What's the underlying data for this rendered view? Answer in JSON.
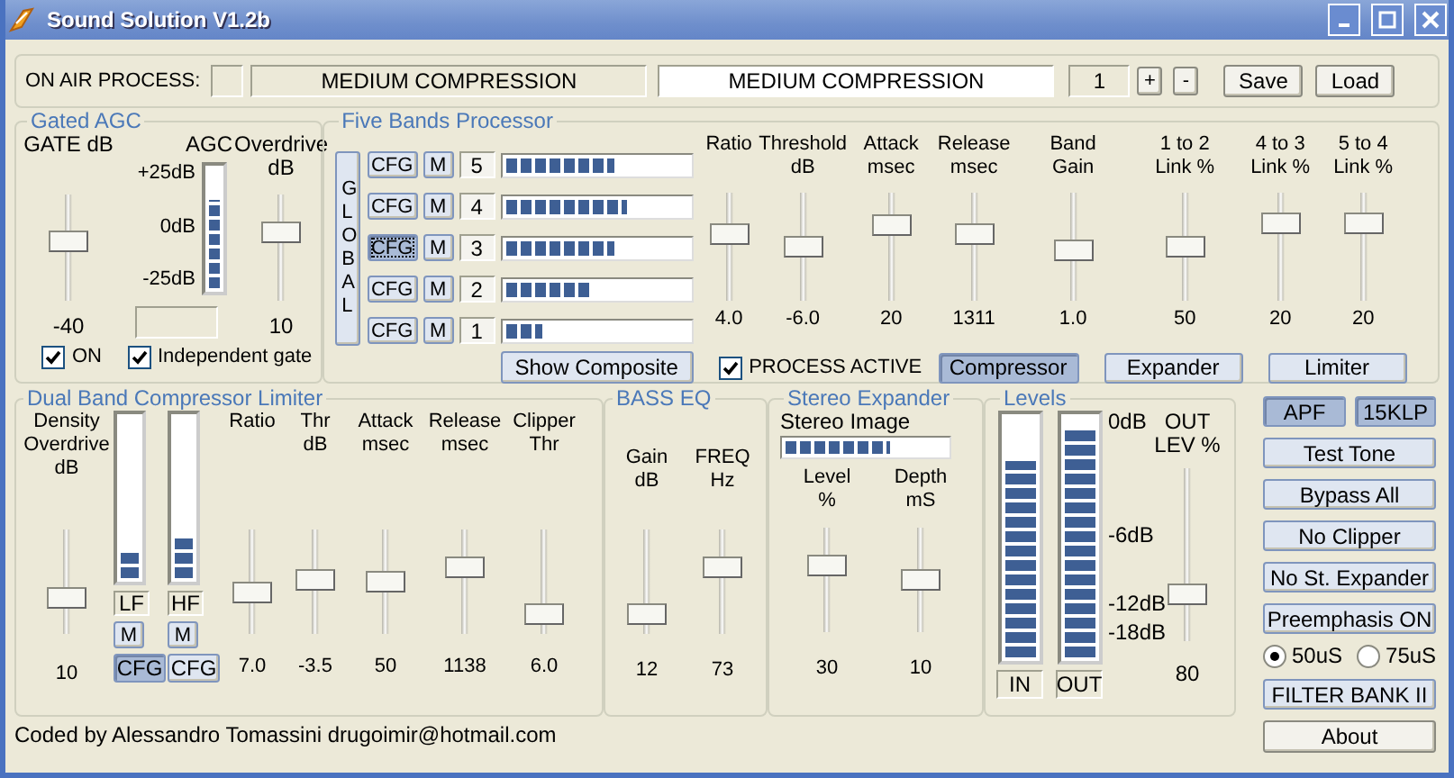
{
  "window": {
    "title": "Sound Solution V1.2b"
  },
  "on_air": {
    "label": "ON AIR PROCESS:",
    "current": "MEDIUM COMPRESSION",
    "preset_name": "MEDIUM COMPRESSION",
    "preset_number": "1",
    "step_buttons": [
      "+",
      "-"
    ],
    "buttons": [
      "Save",
      "Load"
    ]
  },
  "gated_agc": {
    "title": "Gated AGC",
    "gate": {
      "label": "GATE dB",
      "value": "-40",
      "level": 0.58
    },
    "agc": {
      "label": "AGC",
      "scale": [
        "+25dB",
        "0dB",
        "-25dB"
      ],
      "level": 0.75
    },
    "overdrive": {
      "label": "Overdrive\ndB",
      "value": "10",
      "level": 0.67
    },
    "checkboxes": [
      {
        "label": "ON",
        "checked": true
      },
      {
        "label": "Independent gate",
        "checked": true
      }
    ]
  },
  "five_bands": {
    "title": "Five Bands Processor",
    "global_button": "GLOBAL",
    "bands": [
      {
        "cfg": "CFG",
        "mute": "M",
        "number": "5",
        "selected": false,
        "level": 0.6
      },
      {
        "cfg": "CFG",
        "mute": "M",
        "number": "4",
        "selected": false,
        "level": 0.67
      },
      {
        "cfg": "CFG",
        "mute": "M",
        "number": "3",
        "selected": true,
        "level": 0.6
      },
      {
        "cfg": "CFG",
        "mute": "M",
        "number": "2",
        "selected": false,
        "level": 0.47
      },
      {
        "cfg": "CFG",
        "mute": "M",
        "number": "1",
        "selected": false,
        "level": 0.2
      }
    ],
    "controls": [
      {
        "label": "Ratio",
        "value": "4.0",
        "level": 0.65
      },
      {
        "label": "Threshold\ndB",
        "value": "-6.0",
        "level": 0.49
      },
      {
        "label": "Attack\nmsec",
        "value": "20",
        "level": 0.75
      },
      {
        "label": "Release\nmsec",
        "value": "1311",
        "level": 0.65
      },
      {
        "label": "Band\nGain",
        "value": "1.0",
        "level": 0.45
      },
      {
        "label": "1 to 2\nLink %",
        "value": "50",
        "level": 0.5
      },
      {
        "label": "4 to 3\nLink %",
        "value": "20",
        "level": 0.77
      },
      {
        "label": "5 to 4\nLink %",
        "value": "20",
        "level": 0.77
      }
    ],
    "show_composite": "Show Composite",
    "process_active": {
      "label": "PROCESS ACTIVE",
      "checked": true
    },
    "modes": [
      {
        "label": "Compressor",
        "selected": true
      },
      {
        "label": "Expander",
        "selected": false
      },
      {
        "label": "Limiter",
        "selected": false
      }
    ]
  },
  "dual_band": {
    "title": "Dual Band Compressor Limiter",
    "density": {
      "label": "Density\nOverdrive\ndB",
      "value": "10",
      "level": 0.3
    },
    "bands": [
      {
        "label": "LF",
        "mute": "M",
        "cfg": "CFG",
        "selected": true,
        "level": 0.17
      },
      {
        "label": "HF",
        "mute": "M",
        "cfg": "CFG",
        "selected": false,
        "level": 0.25
      }
    ],
    "controls": [
      {
        "label": "Ratio",
        "value": "7.0",
        "level": 0.37
      },
      {
        "label": "Thr\ndB",
        "value": "-3.5",
        "level": 0.53
      },
      {
        "label": "Attack\nmsec",
        "value": "50",
        "level": 0.5
      },
      {
        "label": "Release\nmsec",
        "value": "1138",
        "level": 0.68
      },
      {
        "label": "Clipper\nThr",
        "value": "6.0",
        "level": 0.1
      }
    ]
  },
  "bass_eq": {
    "title": "BASS EQ",
    "controls": [
      {
        "label": "Gain\ndB",
        "value": "12",
        "level": 0.1
      },
      {
        "label": "FREQ\nHz",
        "value": "73",
        "level": 0.67
      }
    ]
  },
  "stereo_expander": {
    "title": "Stereo Expander",
    "image": {
      "label": "Stereo Image",
      "level": 0.65
    },
    "controls": [
      {
        "label": "Level\n%",
        "value": "30",
        "level": 0.67
      },
      {
        "label": "Depth\nmS",
        "value": "10",
        "level": 0.5
      }
    ]
  },
  "levels": {
    "title": "Levels",
    "meters": [
      {
        "label": "IN",
        "level": 0.82
      },
      {
        "label": "OUT",
        "level": 0.95
      }
    ],
    "scale": [
      "0dB",
      "-6dB",
      "-12dB",
      "-18dB"
    ],
    "output": {
      "label": "OUT\nLEV %",
      "value": "80",
      "level": 0.24
    }
  },
  "filters": [
    {
      "label": "APF",
      "selected": true
    },
    {
      "label": "15KLP",
      "selected": true
    }
  ],
  "actions": [
    {
      "label": "Test Tone",
      "selected": false
    },
    {
      "label": "Bypass All",
      "selected": false
    },
    {
      "label": "No Clipper",
      "selected": false
    },
    {
      "label": "No St. Expander",
      "selected": false
    },
    {
      "label": "Preemphasis ON",
      "selected": false
    }
  ],
  "preemphasis": [
    {
      "label": "50uS",
      "selected": true
    },
    {
      "label": "75uS",
      "selected": false
    }
  ],
  "filter_bank": "FILTER BANK II",
  "about": "About",
  "footer": "Coded by Alessandro Tomassini drugoimir@hotmail.com"
}
